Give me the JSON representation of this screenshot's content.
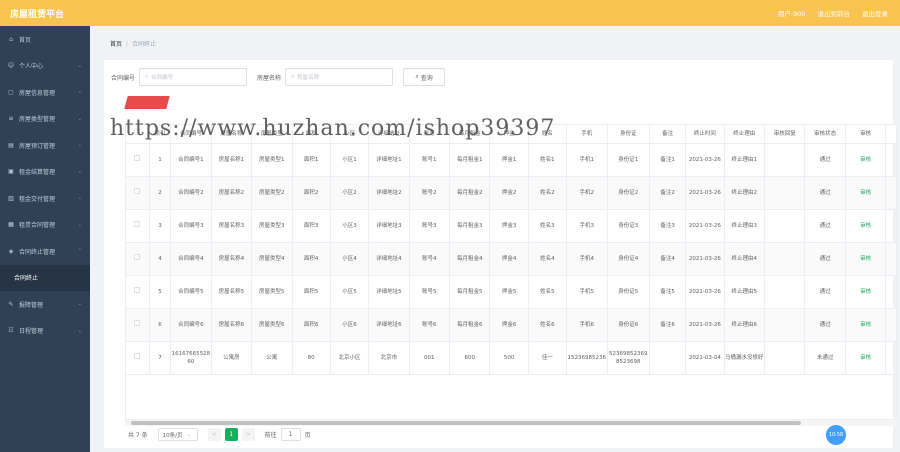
{
  "header": {
    "title": "房屋租赁平台",
    "user": "用户:900",
    "backend_link": "退出到前台",
    "logout": "退出登录"
  },
  "sidebar": {
    "items": [
      {
        "label": "首页",
        "icon": "home-icon"
      },
      {
        "label": "个人中心",
        "icon": "user-icon"
      },
      {
        "label": "房屋信息管理",
        "icon": "house-icon"
      },
      {
        "label": "房屋类型管理",
        "icon": "list-icon"
      },
      {
        "label": "房屋预订管理",
        "icon": "calendar-icon"
      },
      {
        "label": "租金结算管理",
        "icon": "money-icon"
      },
      {
        "label": "租金交付管理",
        "icon": "pay-icon"
      },
      {
        "label": "租赁合同管理",
        "icon": "contract-icon"
      },
      {
        "label": "合同终止管理",
        "icon": "stop-icon"
      },
      {
        "label": "合同终止",
        "icon": ""
      },
      {
        "label": "报障管理",
        "icon": "wrench-icon"
      },
      {
        "label": "日程管理",
        "icon": "schedule-icon"
      }
    ]
  },
  "breadcrumb": {
    "home": "首页",
    "sep": "/",
    "current": "合同终止"
  },
  "search": {
    "contract_label": "合同编号",
    "contract_placeholder": "合同编号",
    "house_label": "房屋名称",
    "house_placeholder": "房屋名称",
    "button": "查询"
  },
  "watermark": "https://www.huzhan.com/ishop39397",
  "table": {
    "columns": [
      "",
      "索引",
      "合同编号",
      "房屋名称",
      "房屋类型",
      "面积",
      "小区",
      "详细地址",
      "账号",
      "每月租金",
      "押金",
      "姓名",
      "手机",
      "身份证",
      "备注",
      "终止时间",
      "终止理由",
      "审核回复",
      "审核状态",
      "审核",
      ""
    ],
    "rows": [
      [
        "1",
        "合同编号1",
        "房屋名称1",
        "房屋类型1",
        "面积1",
        "小区1",
        "详细地址1",
        "账号1",
        "每月租金1",
        "押金1",
        "姓名1",
        "手机1",
        "身份证1",
        "备注1",
        "2021-03-26",
        "终止理由1",
        "",
        "通过",
        "审核"
      ],
      [
        "2",
        "合同编号2",
        "房屋名称2",
        "房屋类型2",
        "面积2",
        "小区2",
        "详细地址2",
        "账号2",
        "每月租金2",
        "押金2",
        "姓名2",
        "手机2",
        "身份证2",
        "备注2",
        "2021-03-26",
        "终止理由2",
        "",
        "通过",
        "审核"
      ],
      [
        "3",
        "合同编号3",
        "房屋名称3",
        "房屋类型3",
        "面积3",
        "小区3",
        "详细地址3",
        "账号3",
        "每月租金3",
        "押金3",
        "姓名3",
        "手机3",
        "身份证3",
        "备注3",
        "2021-03-26",
        "终止理由3",
        "",
        "通过",
        "审核"
      ],
      [
        "4",
        "合同编号4",
        "房屋名称4",
        "房屋类型4",
        "面积4",
        "小区4",
        "详细地址4",
        "账号4",
        "每月租金4",
        "押金4",
        "姓名4",
        "手机4",
        "身份证4",
        "备注4",
        "2021-03-26",
        "终止理由4",
        "",
        "通过",
        "审核"
      ],
      [
        "5",
        "合同编号5",
        "房屋名称5",
        "房屋类型5",
        "面积5",
        "小区5",
        "详细地址5",
        "账号5",
        "每月租金5",
        "押金5",
        "姓名5",
        "手机5",
        "身份证5",
        "备注5",
        "2021-03-26",
        "终止理由5",
        "",
        "通过",
        "审核"
      ],
      [
        "6",
        "合同编号6",
        "房屋名称6",
        "房屋类型6",
        "面积6",
        "小区6",
        "详细地址6",
        "账号6",
        "每月租金6",
        "押金6",
        "姓名6",
        "手机6",
        "身份证6",
        "备注6",
        "2021-03-26",
        "终止理由6",
        "",
        "通过",
        "审核"
      ],
      [
        "7",
        "1616766552860",
        "公寓房",
        "公寓",
        "80",
        "北京小区",
        "北京市",
        "001",
        "600",
        "500",
        "佳一",
        "15236985236",
        "523698523698523698",
        "",
        "2021-03-04",
        "马桶漏水没修好",
        "",
        "未通过",
        "审核"
      ]
    ]
  },
  "pagination": {
    "total": "共 7 条",
    "page_size": "10条/页",
    "prev": "<",
    "page": "1",
    "next": ">",
    "goto_label": "前往",
    "goto_value": "1",
    "page_suffix": "页"
  },
  "badge": "10:58"
}
